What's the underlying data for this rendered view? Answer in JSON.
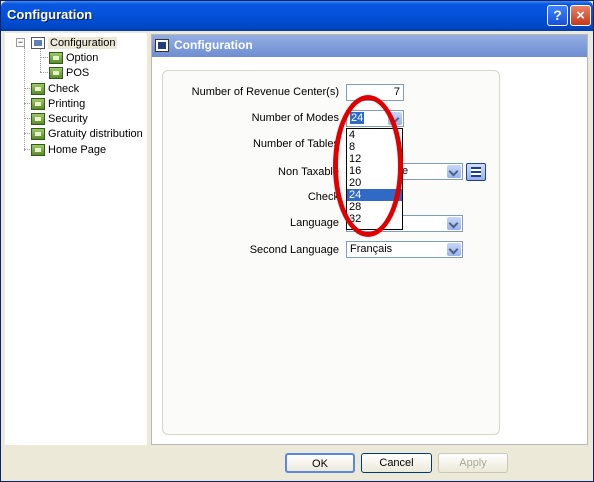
{
  "window": {
    "title": "Configuration",
    "help_label": "?",
    "close_label": "×"
  },
  "sidebar": {
    "items": [
      {
        "label": "Configuration"
      },
      {
        "label": "Option"
      },
      {
        "label": "POS"
      },
      {
        "label": "Check"
      },
      {
        "label": "Printing"
      },
      {
        "label": "Security"
      },
      {
        "label": "Gratuity distribution"
      },
      {
        "label": "Home Page"
      }
    ],
    "expander": "−"
  },
  "main": {
    "header": "Configuration",
    "form": {
      "revenue_centers": {
        "label": "Number of Revenue Center(s)",
        "value": "7"
      },
      "modes": {
        "label": "Number of Modes",
        "value": "24",
        "options": [
          "4",
          "8",
          "12",
          "16",
          "20",
          "24",
          "28",
          "32"
        ],
        "selected": "24"
      },
      "tables": {
        "label": "Number of Tables"
      },
      "non_taxable": {
        "label": "Non Taxable",
        "value": "e"
      },
      "check": {
        "label": "Check"
      },
      "language": {
        "label": "Language"
      },
      "second_language": {
        "label": "Second Language",
        "value": "Français"
      }
    }
  },
  "buttons": {
    "ok": "OK",
    "cancel": "Cancel",
    "apply": "Apply"
  },
  "colors": {
    "highlight": "#316ac5",
    "annotation": "#e00000"
  }
}
